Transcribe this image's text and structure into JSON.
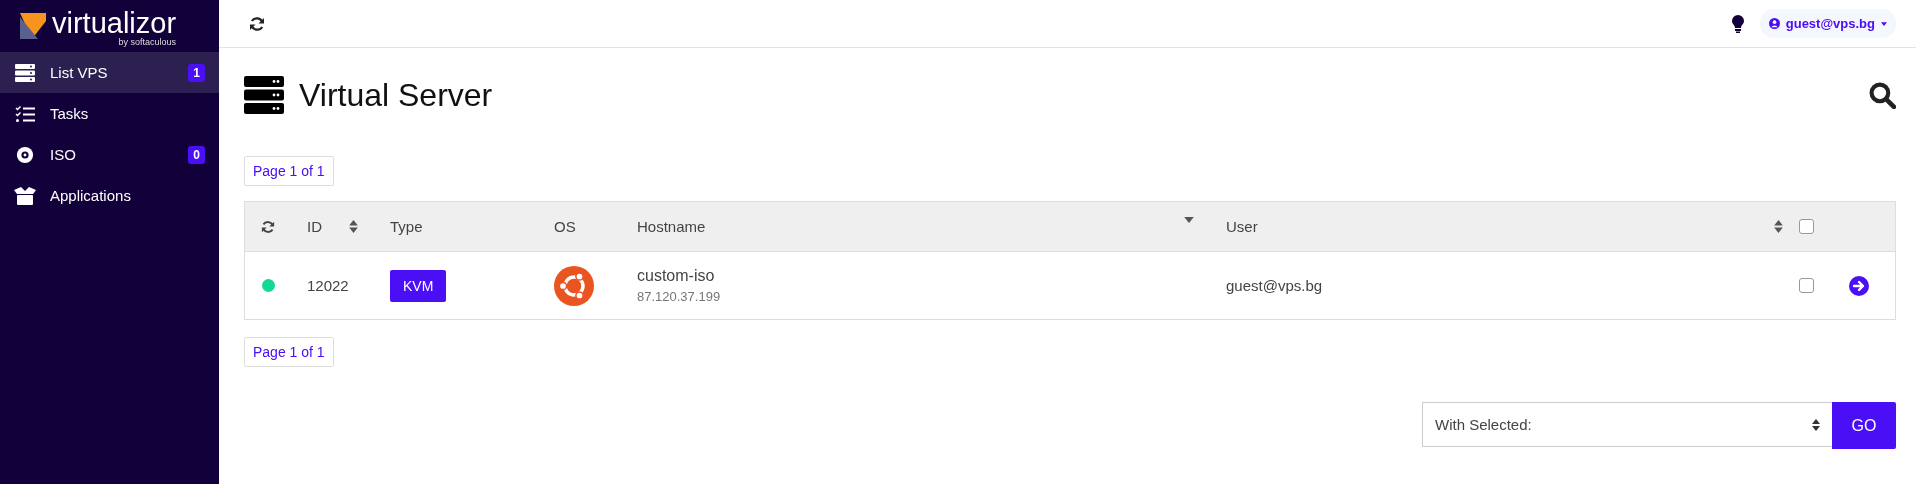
{
  "sidebar": {
    "logo": {
      "name": "virtualizor",
      "tagline": "by softaculous"
    },
    "items": [
      {
        "label": "List VPS",
        "kind": "server",
        "selected": true,
        "badge": "1"
      },
      {
        "label": "Tasks",
        "kind": "tasks",
        "selected": false
      },
      {
        "label": "ISO",
        "kind": "disc",
        "selected": false,
        "badge": "0"
      },
      {
        "label": "Applications",
        "kind": "box",
        "selected": false
      }
    ]
  },
  "topbar": {
    "user": "guest@vps.bg"
  },
  "page": {
    "title": "Virtual Server"
  },
  "pager_top": "Page 1 of 1",
  "table": {
    "select_all_checked": false,
    "columns": [
      {
        "label": "ID",
        "sortable": true,
        "sorted": false
      },
      {
        "label": "Type",
        "sortable": false,
        "sorted": false
      },
      {
        "label": "OS",
        "sortable": false,
        "sorted": false
      },
      {
        "label": "Hostname",
        "sortable": false,
        "sorted": true
      },
      {
        "label": "User",
        "sortable": true,
        "sorted": false
      }
    ],
    "rows": [
      {
        "online": true,
        "id": "12022",
        "type": "KVM",
        "hostname": "custom-iso",
        "ip": "87.120.37.199",
        "user": "guest@vps.bg",
        "checked": false
      }
    ]
  },
  "pager_bottom": "Page 1 of 1",
  "bulk_action": {
    "value": "With Selected:",
    "button": "GO"
  }
}
